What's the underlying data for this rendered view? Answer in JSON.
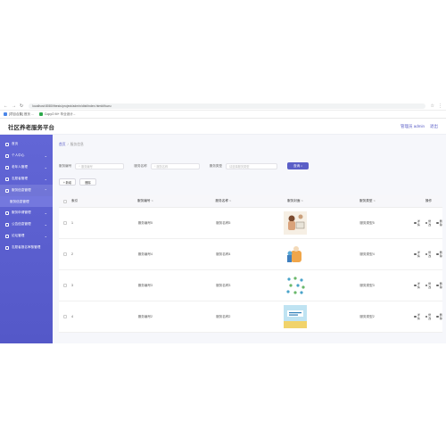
{
  "browser": {
    "url": "localhost:8080/thesis/project/admin/dist/index.html#/fuwu",
    "bookmarks": [
      "[项目合集] 首页 ...",
      "CopyO M+ 毕业设计..."
    ]
  },
  "header": {
    "title": "社区养老服务平台",
    "user_label": "管理员 admin",
    "logout_label": "退出"
  },
  "sidebar": {
    "items": [
      {
        "label": "首页"
      },
      {
        "label": "个人中心"
      },
      {
        "label": "老年人管理"
      },
      {
        "label": "志愿者管理"
      },
      {
        "label": "服务信息管理"
      },
      {
        "label": "服务申请管理"
      },
      {
        "label": "公告信息管理"
      },
      {
        "label": "论坛管理"
      },
      {
        "label": "志愿者报名审核管理"
      }
    ],
    "submenu": {
      "label": "服务信息管理"
    }
  },
  "breadcrumb": {
    "home": "首页",
    "sep": "/",
    "current": "服务信息"
  },
  "search": {
    "field1_label": "服务编号",
    "field1_placeholder": "服务编号",
    "field2_label": "服务名称",
    "field2_placeholder": "服务名称",
    "field3_label": "服务类型",
    "field3_placeholder": "请选择服务类型",
    "button": "查询"
  },
  "actions": {
    "add": "+ 新增",
    "delete": "删除"
  },
  "table": {
    "headers": {
      "index": "索引",
      "code": "服务编号",
      "name": "服务名称",
      "cover": "服务封面",
      "type": "服务类型",
      "op": "操作"
    },
    "rows": [
      {
        "index": "1",
        "code": "服务编号5",
        "name": "服务名称5",
        "type": "服务类型5"
      },
      {
        "index": "2",
        "code": "服务编号4",
        "name": "服务名称4",
        "type": "服务类型4"
      },
      {
        "index": "3",
        "code": "服务编号3",
        "name": "服务名称3",
        "type": "服务类型3"
      },
      {
        "index": "4",
        "code": "服务编号2",
        "name": "服务名称2",
        "type": "服务类型2"
      }
    ],
    "ops": {
      "view": "详情",
      "edit": "修改",
      "delete": "删除"
    }
  },
  "colors": {
    "accent": "#5b5fc7",
    "sidebar": "#5458c8"
  }
}
